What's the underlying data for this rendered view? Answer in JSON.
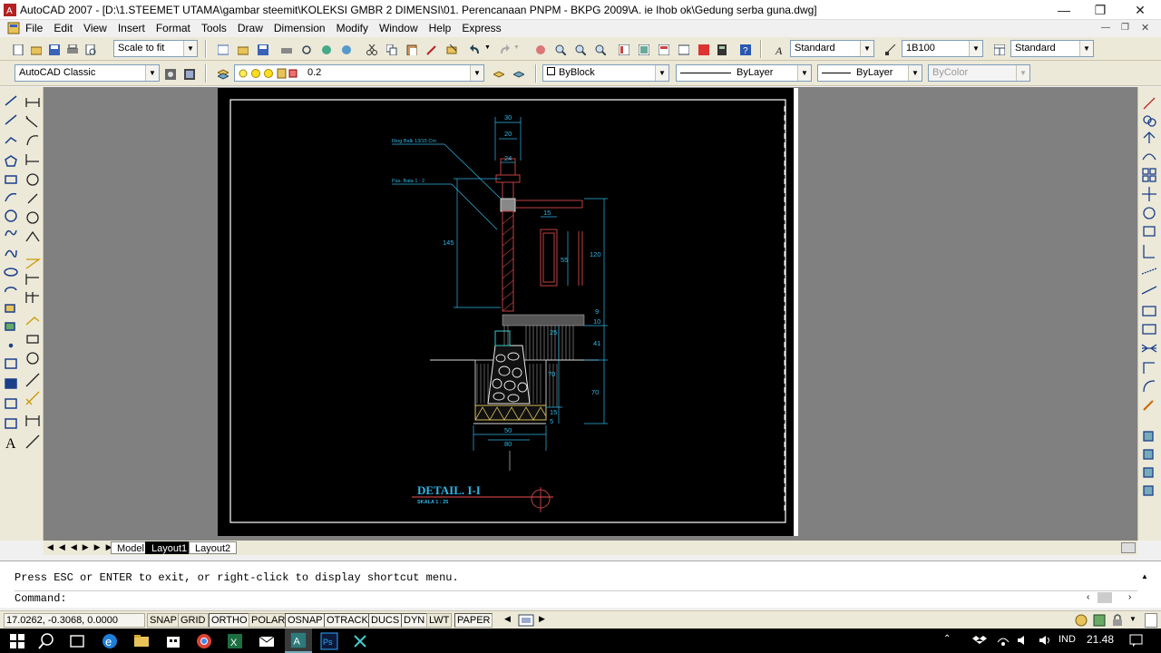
{
  "window": {
    "title": "AutoCAD 2007 - [D:\\1.STEEMET UTAMA\\gambar steemit\\KOLEKSI GMBR 2 DIMENSI\\01. Perencanaan PNPM - BKPG 2009\\A. ie Ihob ok\\Gedung serba guna.dwg]"
  },
  "menu": [
    "File",
    "Edit",
    "View",
    "Insert",
    "Format",
    "Tools",
    "Draw",
    "Dimension",
    "Modify",
    "Window",
    "Help",
    "Express"
  ],
  "toolbar": {
    "plot_scale": "Scale to fit",
    "text_style": "Standard",
    "dim_style": "1B100",
    "table_style": "Standard",
    "workspace": "AutoCAD Classic",
    "layer": "0.2",
    "color": "ByBlock",
    "linetype": "ByLayer",
    "lineweight": "ByLayer",
    "plotstyle": "ByColor"
  },
  "drawing": {
    "title": "DETAIL. I-I",
    "scale": "SKALA  1 : 25",
    "callout1": "Ring Balk 13/15 Cm",
    "callout2": "Pas. Bata 1 : 2",
    "dims": {
      "d30": "30",
      "d20": "20",
      "d24": "24",
      "d15a": "15",
      "d55": "55",
      "d145": "145",
      "d120": "120",
      "d9": "9",
      "d10": "10",
      "d25": "25",
      "d41": "41",
      "d70a": "70",
      "d70b": "70",
      "d15b": "15",
      "d5": "5",
      "d50": "50",
      "d80": "80"
    }
  },
  "tabs": [
    "Model",
    "Layout1",
    "Layout2"
  ],
  "command": {
    "history": "Press ESC or ENTER to exit, or right-click to display shortcut menu.",
    "prompt": "Command:"
  },
  "status": {
    "coords": "17.0262, -0.3068, 0.0000",
    "buttons": [
      "SNAP",
      "GRID",
      "ORTHO",
      "POLAR",
      "OSNAP",
      "OTRACK",
      "DUCS",
      "DYN",
      "LWT",
      "PAPER"
    ]
  },
  "taskbar": {
    "lang": "IND",
    "time": "21.48"
  }
}
